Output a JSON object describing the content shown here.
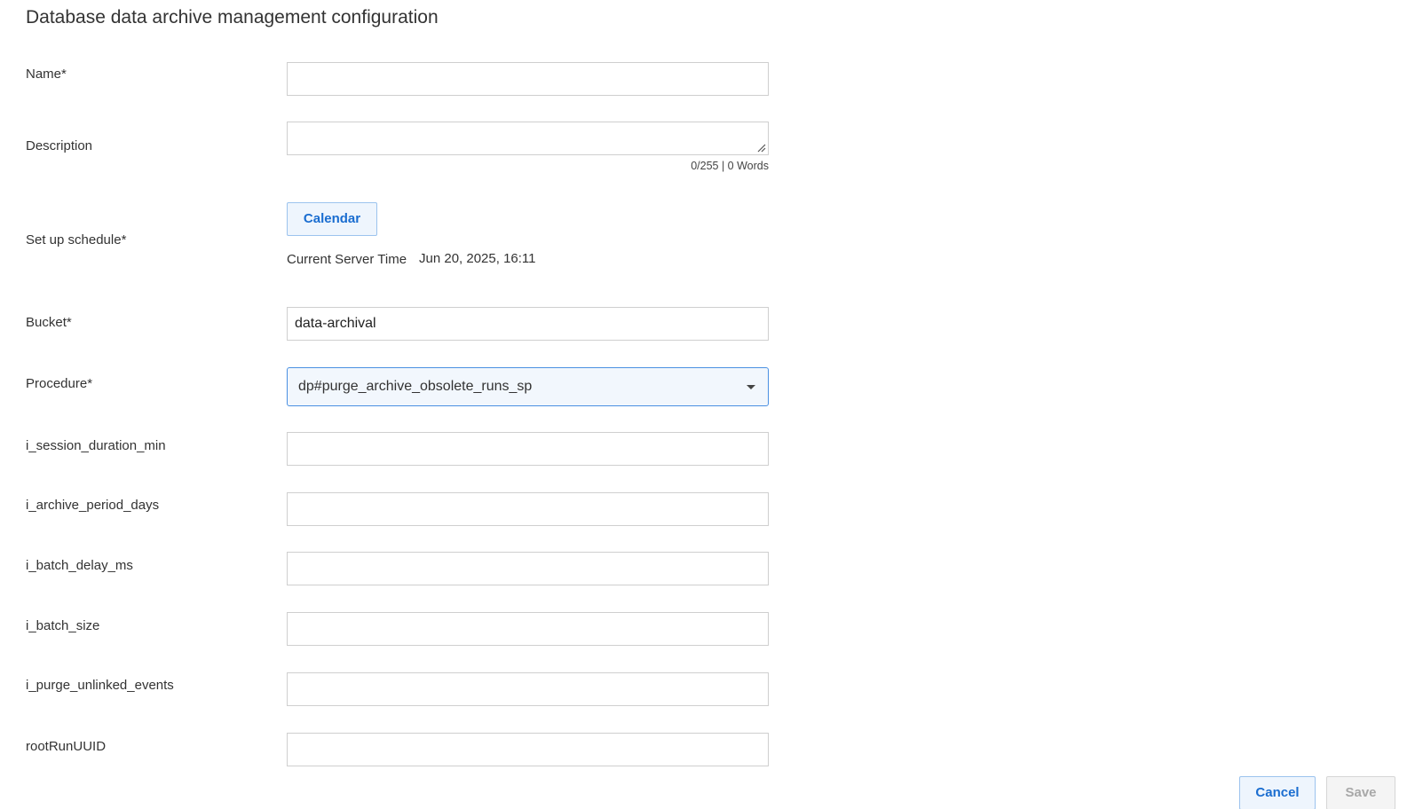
{
  "title": "Database data archive management configuration",
  "form": {
    "name": {
      "label": "Name*",
      "value": ""
    },
    "description": {
      "label": "Description",
      "value": "",
      "counter": "0/255 | 0 Words"
    },
    "schedule": {
      "label": "Set up schedule*",
      "calendar_button": "Calendar",
      "server_time_label": "Current Server Time",
      "server_time_value": "Jun 20, 2025, 16:11"
    },
    "bucket": {
      "label": "Bucket*",
      "value": "data-archival"
    },
    "procedure": {
      "label": "Procedure*",
      "value": "dp#purge_archive_obsolete_runs_sp"
    },
    "params": [
      {
        "label": "i_session_duration_min",
        "value": ""
      },
      {
        "label": "i_archive_period_days",
        "value": ""
      },
      {
        "label": "i_batch_delay_ms",
        "value": ""
      },
      {
        "label": "i_batch_size",
        "value": ""
      },
      {
        "label": "i_purge_unlinked_events",
        "value": ""
      },
      {
        "label": "rootRunUUID",
        "value": ""
      }
    ]
  },
  "footer": {
    "cancel_label": "Cancel",
    "save_label": "Save"
  },
  "colors": {
    "accent": "#1a6dd0",
    "border": "#cfcfcf",
    "focus_border": "#4a90e2"
  }
}
